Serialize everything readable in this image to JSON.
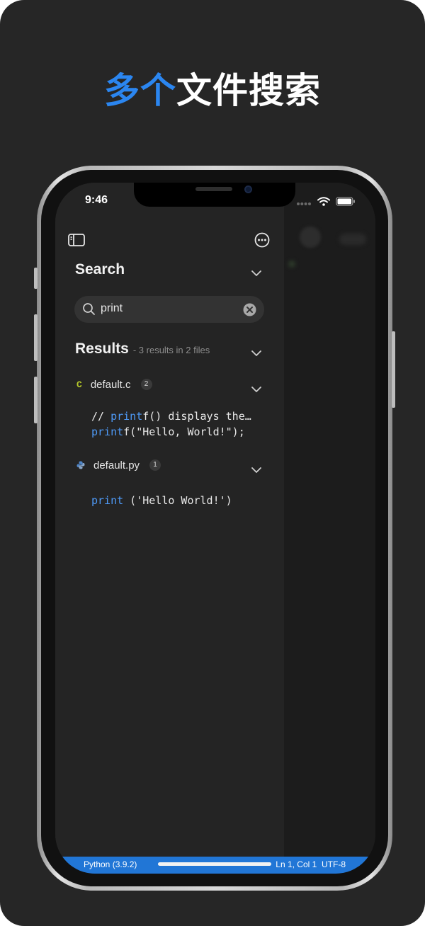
{
  "promo": {
    "headline_accent": "多个",
    "headline_rest": "文件搜索"
  },
  "status_bar": {
    "time": "9:46",
    "signal_icon": "cellular-dots-icon",
    "wifi_icon": "wifi-icon",
    "battery_icon": "battery-icon"
  },
  "toolbar": {
    "sidebar_toggle_icon": "sidebar-icon",
    "more_icon": "ellipsis-circle-icon"
  },
  "search": {
    "title": "Search",
    "query": "print"
  },
  "results": {
    "title": "Results",
    "summary": "- 3 results in 2 files",
    "files": [
      {
        "name": "default.c",
        "language_icon": "C",
        "count": "2",
        "lines": [
          {
            "prefix": "// ",
            "match": "print",
            "suffix": "f() displays the…"
          },
          {
            "prefix": "",
            "match": "print",
            "suffix": "f(\"Hello, World!\");"
          }
        ]
      },
      {
        "name": "default.py",
        "language_icon": "python-icon",
        "count": "1",
        "lines": [
          {
            "prefix": "",
            "match": "print",
            "suffix": " ('Hello World!')"
          }
        ]
      }
    ]
  },
  "editor_status": {
    "language": "Python (3.9.2)",
    "position": "Ln 1, Col 1",
    "encoding": "UTF-8"
  },
  "colors": {
    "accent": "#2b86f0",
    "background": "#262626",
    "status_bar": "#2176d6",
    "keyword": "#4e9af7",
    "c_icon": "#b6c92a"
  }
}
